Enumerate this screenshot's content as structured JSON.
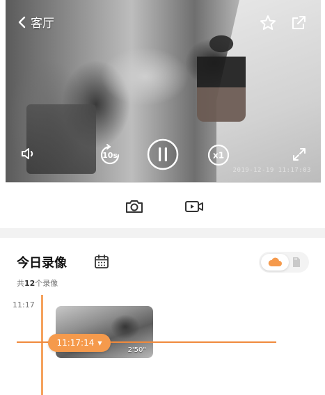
{
  "header": {
    "title": "客厅"
  },
  "video": {
    "timestamp": "2019-12-19 11:17:03",
    "controls": {
      "rewind_label": "10s",
      "speed_label": "x1"
    }
  },
  "records": {
    "title": "今日录像",
    "count_prefix": "共",
    "count_value": "12",
    "count_suffix": "个录像"
  },
  "timeline": {
    "hour_label": "11:17",
    "current_time": "11:17:14",
    "clip_duration": "2'50\""
  },
  "colors": {
    "accent": "#f59a4c",
    "accent_line": "#f08a3c"
  }
}
